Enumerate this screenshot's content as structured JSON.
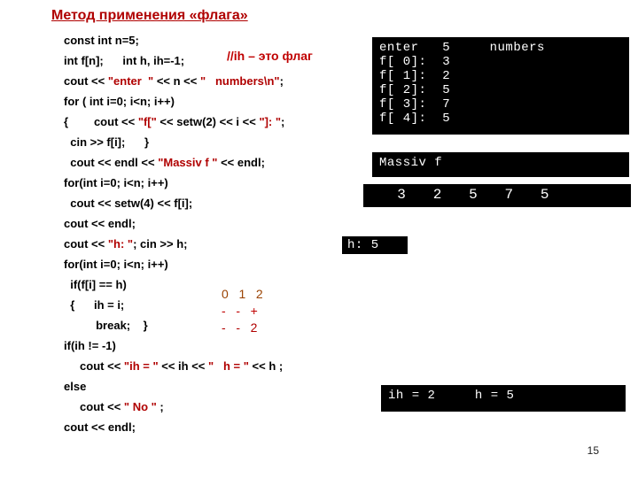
{
  "title": "Метод применения «флага»",
  "flag_comment": "//ih – это флаг",
  "code": {
    "l0": "const int n=5;",
    "l1": "int f[n];      int h, ih=-1; ",
    "l2a": "cout << ",
    "l2b": "\"enter  \"",
    "l2c": " << n << ",
    "l2d": "\"   numbers\\n\"",
    "l2e": ";",
    "l3": "for ( int i=0; i<n; i++)",
    "l4a": "{        cout << ",
    "l4b": "\"f[\"",
    "l4c": " << setw(2) << i << ",
    "l4d": "\"]: \"",
    "l4e": ";",
    "l5": "  cin >> f[i];      }",
    "l6a": "  cout << endl << ",
    "l6b": "\"Massiv f \"",
    "l6c": " << endl;",
    "l7": "for(int i=0; i<n; i++)",
    "l8": "  cout << setw(4) << f[i];",
    "l9": "cout << endl;",
    "l10a": "cout << ",
    "l10b": "\"h: \"",
    "l10c": "; cin >> h;",
    "l11": "for(int i=0; i<n; i++)",
    "l12": "  if(f[i] == h)",
    "l13": "  {      ih = i;",
    "l14": "          break;    }",
    "l15": "if(ih != -1)",
    "l16a": "     cout << ",
    "l16b": "\"ih = \"",
    "l16c": " << ih << ",
    "l16d": "\"   h = \"",
    "l16e": " << h ;",
    "l17": "else",
    "l18a": "     cout << ",
    "l18b": "\" No \"",
    "l18c": " ;",
    "l19": "cout << endl;"
  },
  "demo": {
    "r0": "0   1   2",
    "r1": "-   -   +",
    "r2": "-   -   2"
  },
  "term1": "enter   5     numbers\nf[ 0]:  3\nf[ 1]:  2\nf[ 2]:  5\nf[ 3]:  7\nf[ 4]:  5",
  "term2": "Massiv f",
  "term3": "   3   2   5   7   5",
  "term4": "h: 5",
  "term5": "ih = 2     h = 5",
  "page_num": "15"
}
